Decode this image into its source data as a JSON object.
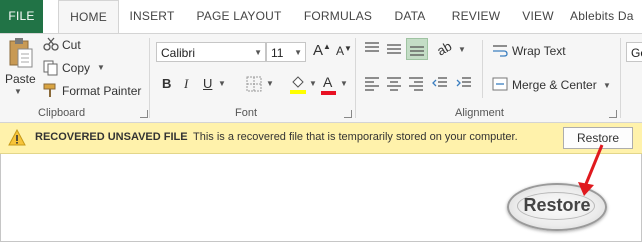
{
  "tabs": [
    "FILE",
    "HOME",
    "INSERT",
    "PAGE LAYOUT",
    "FORMULAS",
    "DATA",
    "REVIEW",
    "VIEW",
    "Ablebits Da"
  ],
  "clipboard": {
    "paste": "Paste",
    "cut": "Cut",
    "copy": "Copy",
    "format_painter": "Format Painter",
    "group_label": "Clipboard"
  },
  "font": {
    "name": "Calibri",
    "size": "11",
    "group_label": "Font"
  },
  "alignment": {
    "wrap_text": "Wrap Text",
    "merge_center": "Merge & Center",
    "group_label": "Alignment"
  },
  "number": {
    "format_partial": "Ge"
  },
  "infobar": {
    "title": "RECOVERED UNSAVED FILE",
    "message": "This is a recovered file that is temporarily stored on your computer.",
    "restore_label": "Restore"
  },
  "callout": {
    "label": "Restore"
  },
  "colors": {
    "file_tab": "#217346",
    "infobar": "#fff2ab",
    "arrow": "#e0191e",
    "font_color_underline": "#e81123",
    "fill_color_underline": "#ffff00"
  }
}
